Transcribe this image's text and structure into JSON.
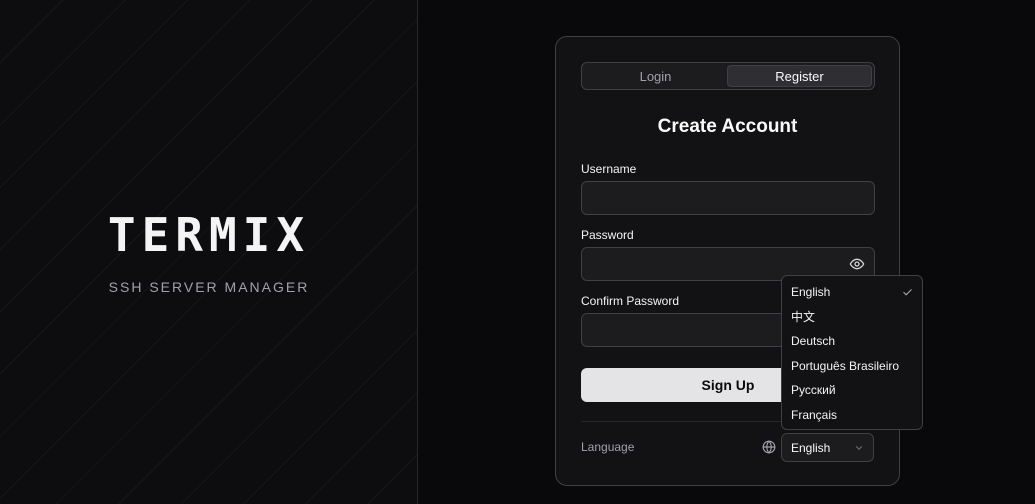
{
  "brand": {
    "title": "TERMIX",
    "subtitle": "SSH SERVER MANAGER"
  },
  "auth": {
    "tabs": [
      {
        "label": "Login",
        "active": false
      },
      {
        "label": "Register",
        "active": true
      }
    ],
    "title": "Create Account",
    "fields": {
      "username": {
        "label": "Username",
        "value": ""
      },
      "password": {
        "label": "Password",
        "value": ""
      },
      "confirm_password": {
        "label": "Confirm Password",
        "value": ""
      }
    },
    "submit_label": "Sign Up",
    "language": {
      "label": "Language",
      "selected": "English",
      "options": [
        "English",
        "中文",
        "Deutsch",
        "Português Brasileiro",
        "Русский",
        "Français"
      ]
    }
  },
  "icons": {
    "password_toggle": "eye-icon",
    "language": "globe-icon",
    "select_arrow": "chevron-down-icon",
    "selected_option": "check-icon"
  },
  "colors": {
    "background": "#09090b",
    "card": "#121214",
    "border": "#3f3f46",
    "button": "#e4e4e7"
  }
}
